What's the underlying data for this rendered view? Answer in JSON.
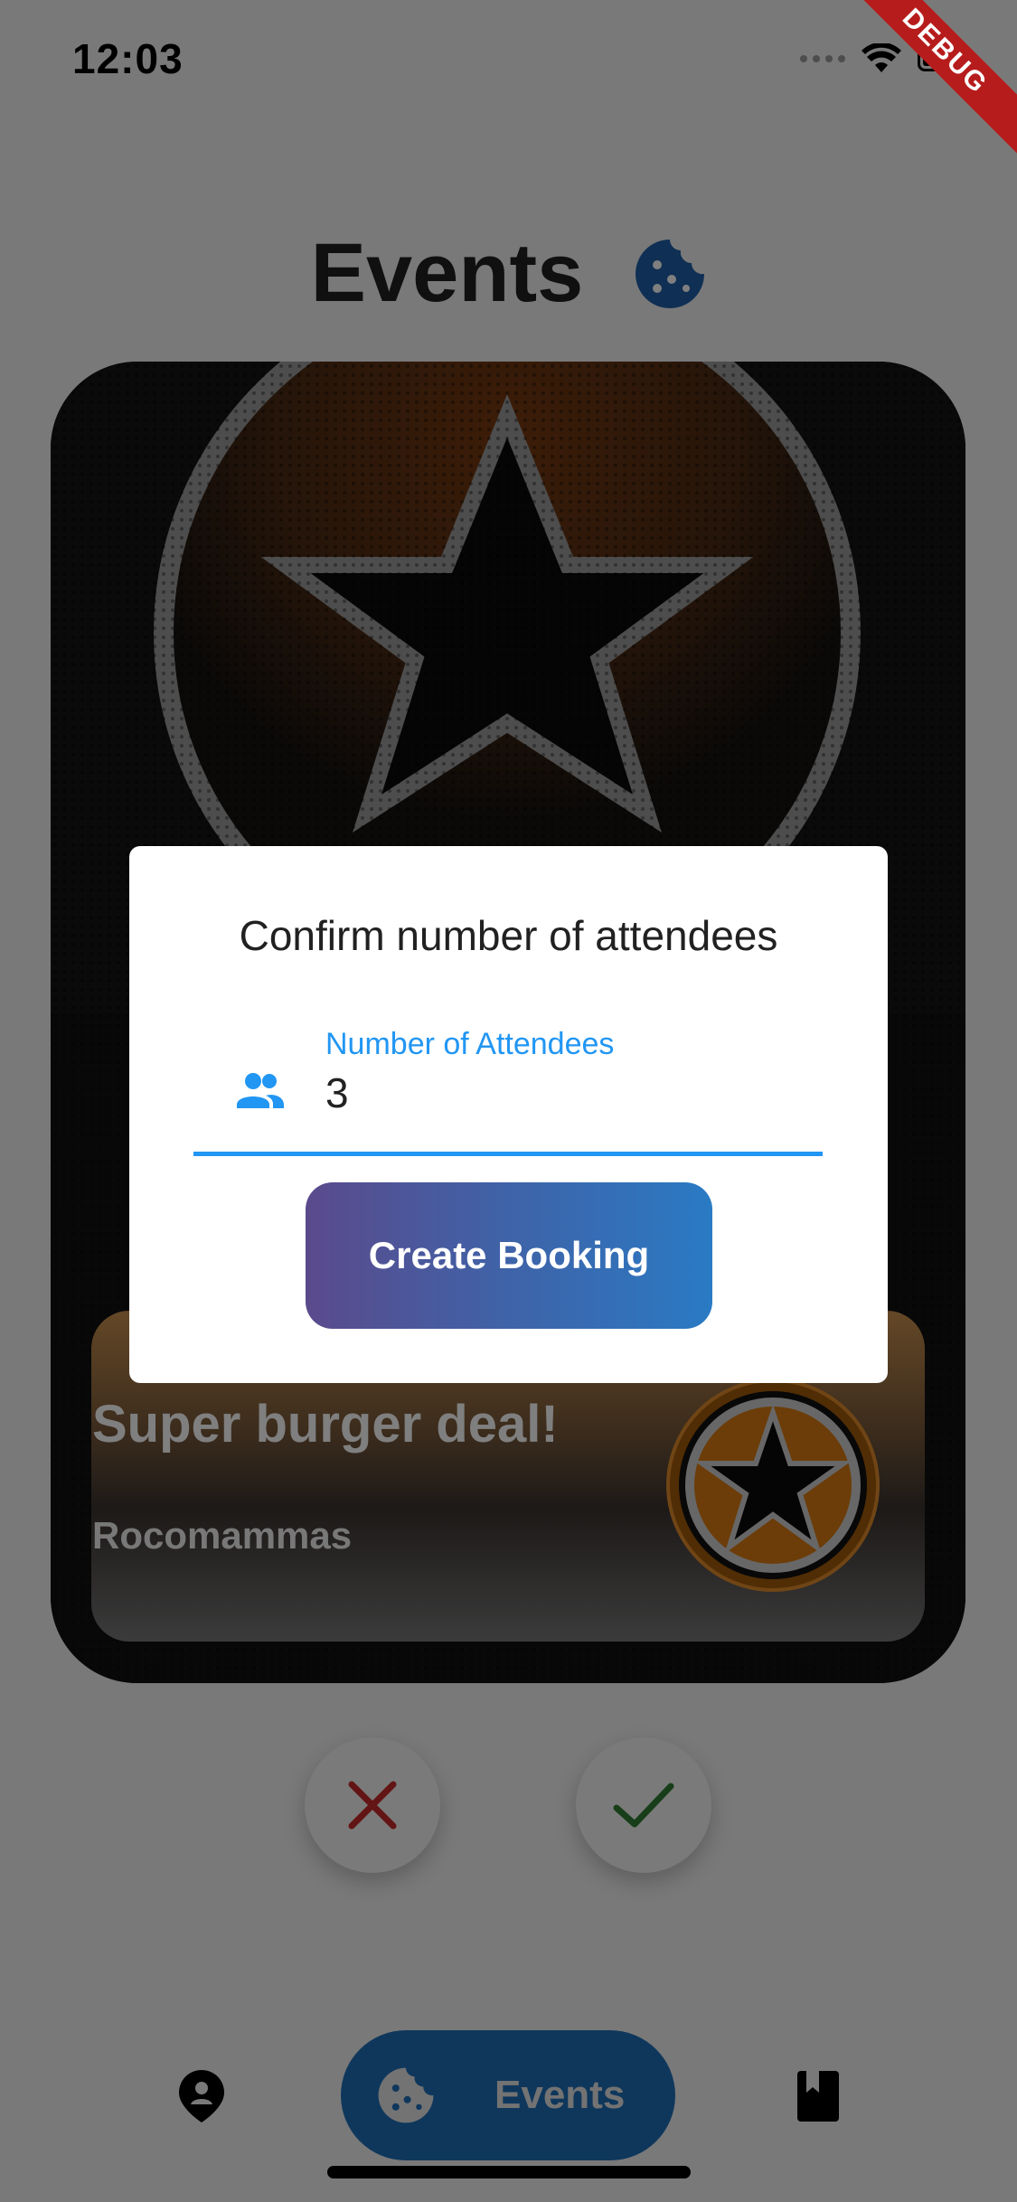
{
  "status_bar": {
    "time": "12:03"
  },
  "debug_banner": "DEBUG",
  "header": {
    "title": "Events",
    "icon": "cookie-icon"
  },
  "event_card": {
    "title": "Super burger deal!",
    "venue": "Rocomammas",
    "image_icon": "star-icon"
  },
  "actions": {
    "reject_icon": "close-icon",
    "accept_icon": "check-icon"
  },
  "bottom_nav": {
    "locations_icon": "location-person-icon",
    "events_label": "Events",
    "events_icon": "cookie-icon",
    "bookings_icon": "bookmark-book-icon"
  },
  "dialog": {
    "title": "Confirm number of attendees",
    "field_label": "Number of Attendees",
    "field_value": "3",
    "field_icon": "people-icon",
    "button_label": "Create Booking"
  },
  "colors": {
    "accent_blue": "#2196f3",
    "nav_active": "#1f6fb8",
    "reject_red": "#c62828",
    "accept_green": "#2e7d32",
    "button_gradient_start": "#5a4a8c",
    "button_gradient_end": "#2a7ac4"
  }
}
